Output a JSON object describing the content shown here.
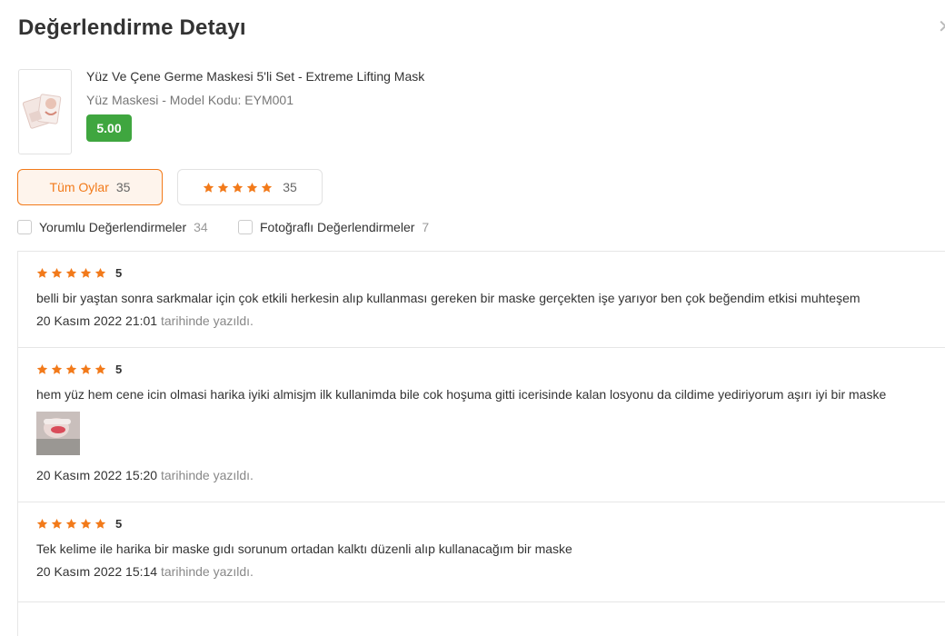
{
  "header": {
    "title": "Değerlendirme Detayı",
    "close_icon": "close-icon"
  },
  "product": {
    "name": "Yüz Ve Çene Germe Maskesi 5'li Set - Extreme Lifting Mask",
    "meta": "Yüz Maskesi - Model Kodu: EYM001",
    "score": "5.00",
    "score_color": "#3fa63f"
  },
  "tabs": [
    {
      "label": "Tüm Oylar",
      "count": "35",
      "active": true
    },
    {
      "stars": 5,
      "count": "35",
      "active": false
    }
  ],
  "filters": [
    {
      "label": "Yorumlu Değerlendirmeler",
      "count": "34",
      "checked": false
    },
    {
      "label": "Fotoğraflı Değerlendirmeler",
      "count": "7",
      "checked": false
    }
  ],
  "accent_color": "#f27a1a",
  "star_color": "#f27a1a",
  "reviews": [
    {
      "rating": "5",
      "text": "belli bir yaştan sonra sarkmalar için çok etkili herkesin alıp kullanması gereken bir maske gerçekten işe yarıyor ben çok beğendim etkisi muhteşem",
      "date": "20 Kasım 2022 21:01",
      "suffix": "tarihinde yazıldı."
    },
    {
      "rating": "5",
      "text": "hem yüz hem cene icin olmasi harika iyiki almisjm ilk kullanimda bile cok hoşuma gitti icerisinde kalan losyonu da cildime yediriyorum aşırı iyi bir maske",
      "date": "20 Kasım 2022 15:20",
      "suffix": "tarihinde yazıldı.",
      "has_photo": true
    },
    {
      "rating": "5",
      "text": "Tek kelime ile harika bir maske gıdı sorunum ortadan kalktı düzenli alıp kullanacağım bir maske",
      "date": "20 Kasım 2022 15:14",
      "suffix": "tarihinde yazıldı."
    }
  ]
}
